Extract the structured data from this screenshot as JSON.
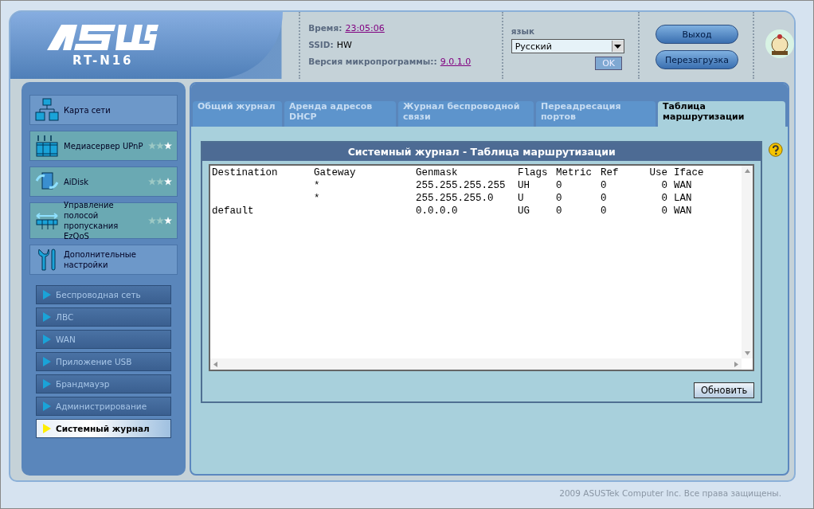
{
  "header": {
    "logo_model": "RT-N16",
    "time_label": "Время:",
    "time": "23:05:06",
    "ssid_label": "SSID:",
    "ssid": "HW",
    "firmware_label": "Версия микропрограммы::",
    "firmware": "9.0.1.0",
    "language_label": "язык",
    "language": "Русский",
    "ok_button": "OK",
    "logout_button": "Выход",
    "reboot_button": "Перезагрузка"
  },
  "sidebar": {
    "items": [
      {
        "label": "Карта сети"
      },
      {
        "label": "Медиасервер UPnP",
        "stars": 1
      },
      {
        "label": "AiDisk",
        "stars": 1
      },
      {
        "label": "Управление полосой пропускания EzQoS",
        "stars": 1
      },
      {
        "label": "Дополнительные настройки"
      }
    ],
    "submenu": [
      {
        "label": "Беспроводная сеть",
        "selected": false
      },
      {
        "label": "ЛВС",
        "selected": false
      },
      {
        "label": "WAN",
        "selected": false
      },
      {
        "label": "Приложение USB",
        "selected": false
      },
      {
        "label": "Брандмауэр",
        "selected": false
      },
      {
        "label": "Администрирование",
        "selected": false
      },
      {
        "label": "Системный журнал",
        "selected": true
      }
    ]
  },
  "tabs": [
    {
      "label": "Общий журнал",
      "selected": false
    },
    {
      "label": "Аренда адресов DHCP",
      "selected": false
    },
    {
      "label": "Журнал беспроводной связи",
      "selected": false
    },
    {
      "label": "Переадресация портов",
      "selected": false
    },
    {
      "label": "Таблица маршрутизации",
      "selected": true
    }
  ],
  "panel": {
    "title": "Системный журнал - Таблица маршрутизации",
    "refresh_button": "Обновить",
    "table": {
      "columns": [
        "Destination",
        "Gateway",
        "Genmask",
        "Flags",
        "Metric",
        "Ref",
        "Use",
        "Iface"
      ],
      "rows": [
        [
          null,
          "*",
          "255.255.255.255",
          "UH",
          "0",
          "0",
          "0",
          "WAN"
        ],
        [
          null,
          "*",
          "255.255.255.0",
          "U",
          "0",
          "0",
          "0",
          "LAN"
        ],
        [
          "default",
          null,
          "0.0.0.0",
          "UG",
          "0",
          "0",
          "0",
          "WAN"
        ]
      ]
    }
  },
  "footer": "2009 ASUSTek Computer Inc. Все права защищены."
}
